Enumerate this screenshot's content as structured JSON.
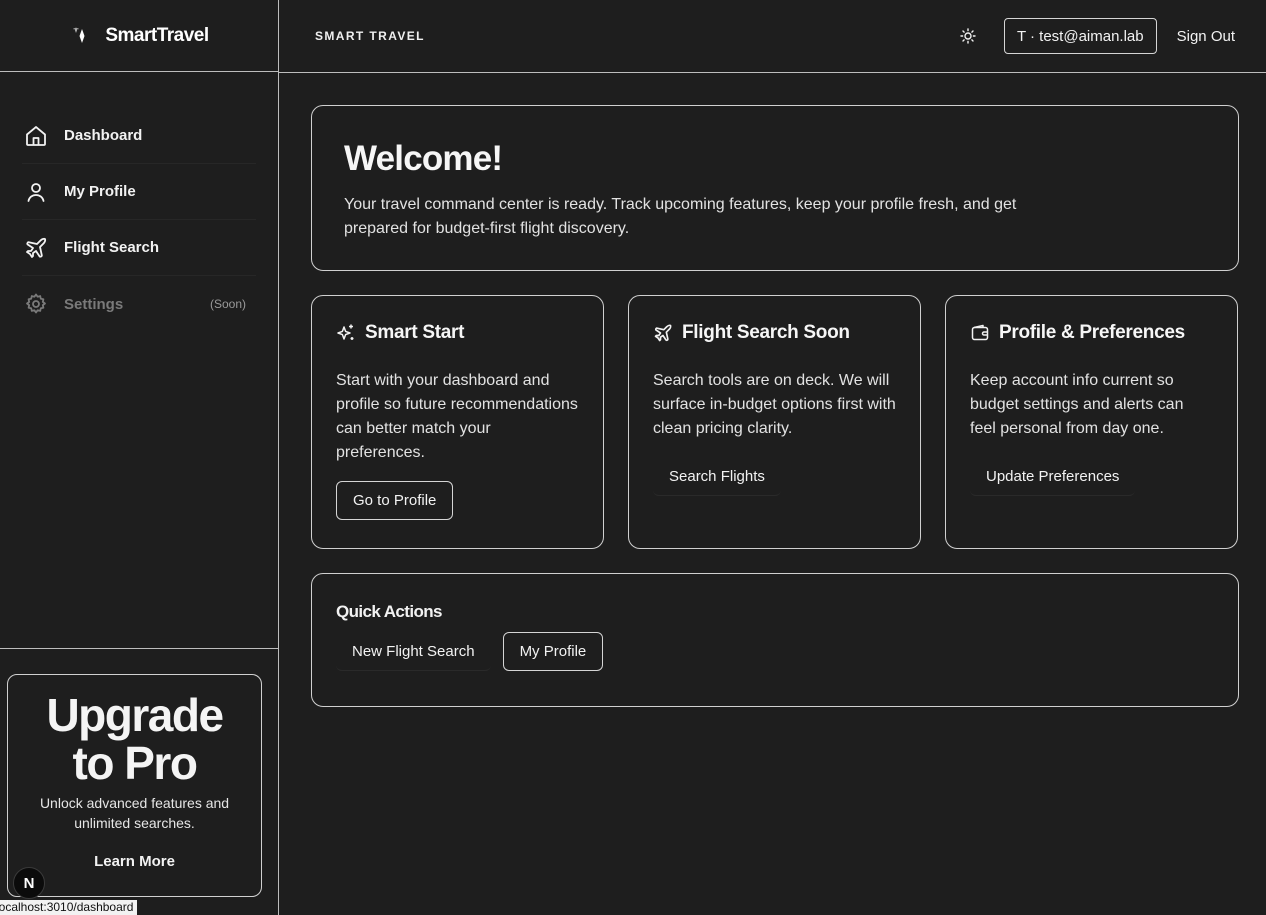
{
  "brand": {
    "name": "SmartTravel"
  },
  "sidebar": {
    "items": [
      {
        "label": "Dashboard",
        "icon": "home-icon"
      },
      {
        "label": "My Profile",
        "icon": "user-icon"
      },
      {
        "label": "Flight Search",
        "icon": "plane-icon"
      },
      {
        "label": "Settings",
        "icon": "gear-icon",
        "badge": "(Soon)"
      }
    ]
  },
  "upgrade": {
    "title_line1": "Upgrade",
    "title_line2": "to Pro",
    "description": "Unlock advanced features and unlimited searches.",
    "link": "Learn More"
  },
  "header": {
    "title": "SMART TRAVEL",
    "user": "T · test@aiman.lab",
    "sign_out": "Sign Out"
  },
  "welcome": {
    "title": "Welcome!",
    "text": "Your travel command center is ready. Track upcoming features, keep your profile fresh, and get prepared for budget-first flight discovery."
  },
  "features": [
    {
      "title": "Smart Start",
      "icon": "sparkles-icon",
      "text": "Start with your dashboard and profile so future recommendations can better match your preferences.",
      "button": "Go to Profile"
    },
    {
      "title": "Flight Search Soon",
      "icon": "plane-icon",
      "text": "Search tools are on deck. We will surface in-budget options first with clean pricing clarity.",
      "button": "Search Flights"
    },
    {
      "title": "Profile & Preferences",
      "icon": "wallet-icon",
      "text": "Keep account info current so budget settings and alerts can feel personal from day one.",
      "button": "Update Preferences"
    }
  ],
  "quick_actions": {
    "title": "Quick Actions",
    "new_search": "New Flight Search",
    "my_profile": "My Profile"
  },
  "dev": {
    "badge": "N",
    "status_url": "localhost:3010/dashboard"
  }
}
